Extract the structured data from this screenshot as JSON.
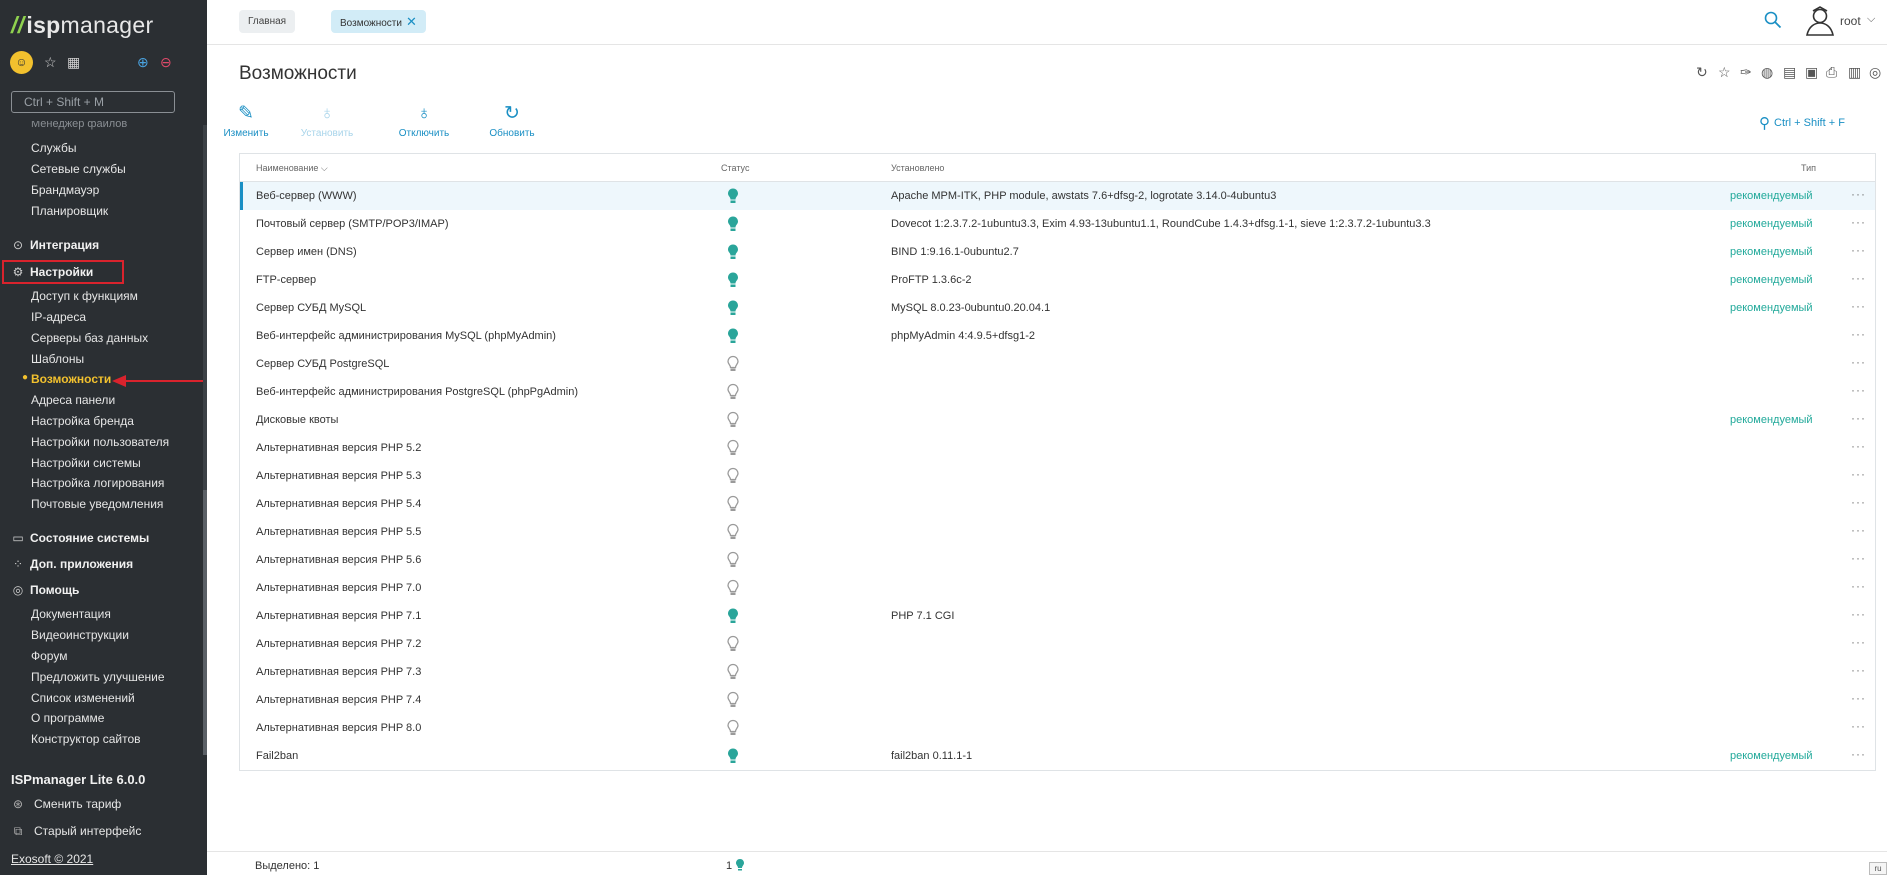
{
  "sidebar": {
    "logo_prefix": "isp",
    "logo_suffix": "manager",
    "search_placeholder": "Ctrl + Shift + M",
    "cut_item": "Менеджер файлов",
    "items_top": [
      "Службы",
      "Сетевые службы",
      "Брандмауэр",
      "Планировщик"
    ],
    "group_integration": "Интеграция",
    "group_settings": "Настройки",
    "settings_items": [
      "Доступ к функциям",
      "IP-адреса",
      "Серверы баз данных",
      "Шаблоны",
      "Возможности",
      "Адреса панели",
      "Настройка бренда",
      "Настройки пользователя",
      "Настройки системы",
      "Настройка логирования",
      "Почтовые уведомления"
    ],
    "group_status": "Состояние системы",
    "group_apps": "Доп. приложения",
    "group_help": "Помощь",
    "help_items": [
      "Документация",
      "Видеоинструкции",
      "Форум",
      "Предложить улучшение",
      "Список изменений",
      "О программе",
      "Конструктор сайтов"
    ],
    "version": "ISPmanager Lite 6.0.0",
    "change_tariff": "Сменить тариф",
    "old_interface": "Старый интерфейс",
    "copyright": "Exosoft © 2021"
  },
  "topbar": {
    "crumb_home": "Главная",
    "crumb_current": "Возможности",
    "user": "root"
  },
  "page": {
    "title": "Возможности",
    "toolbar": {
      "edit": "Изменить",
      "install": "Установить",
      "disable": "Отключить",
      "refresh": "Обновить"
    },
    "filter_hint": "Ctrl + Shift + F",
    "columns": {
      "name": "Наименование",
      "status": "Статус",
      "installed": "Установлено",
      "type": "Тип"
    },
    "rows": [
      {
        "name": "Веб-сервер (WWW)",
        "on": true,
        "installed": "Apache MPM-ITK, PHP module, awstats 7.6+dfsg-2, logrotate 3.14.0-4ubuntu3",
        "type": "рекомендуемый"
      },
      {
        "name": "Почтовый сервер (SMTP/POP3/IMAP)",
        "on": true,
        "installed": "Dovecot 1:2.3.7.2-1ubuntu3.3, Exim 4.93-13ubuntu1.1, RoundCube 1.4.3+dfsg.1-1, sieve 1:2.3.7.2-1ubuntu3.3",
        "type": "рекомендуемый"
      },
      {
        "name": "Сервер имен (DNS)",
        "on": true,
        "installed": "BIND 1:9.16.1-0ubuntu2.7",
        "type": "рекомендуемый"
      },
      {
        "name": "FTP-сервер",
        "on": true,
        "installed": "ProFTP 1.3.6c-2",
        "type": "рекомендуемый"
      },
      {
        "name": "Сервер СУБД MySQL",
        "on": true,
        "installed": "MySQL 8.0.23-0ubuntu0.20.04.1",
        "type": "рекомендуемый"
      },
      {
        "name": "Веб-интерфейс администрирования MySQL (phpMyAdmin)",
        "on": true,
        "installed": "phpMyAdmin 4:4.9.5+dfsg1-2",
        "type": ""
      },
      {
        "name": "Сервер СУБД PostgreSQL",
        "on": false,
        "installed": "",
        "type": ""
      },
      {
        "name": "Веб-интерфейс администрирования PostgreSQL (phpPgAdmin)",
        "on": false,
        "installed": "",
        "type": ""
      },
      {
        "name": "Дисковые квоты",
        "on": false,
        "installed": "",
        "type": "рекомендуемый"
      },
      {
        "name": "Альтернативная версия PHP 5.2",
        "on": false,
        "installed": "",
        "type": ""
      },
      {
        "name": "Альтернативная версия PHP 5.3",
        "on": false,
        "installed": "",
        "type": ""
      },
      {
        "name": "Альтернативная версия PHP 5.4",
        "on": false,
        "installed": "",
        "type": ""
      },
      {
        "name": "Альтернативная версия PHP 5.5",
        "on": false,
        "installed": "",
        "type": ""
      },
      {
        "name": "Альтернативная версия PHP 5.6",
        "on": false,
        "installed": "",
        "type": ""
      },
      {
        "name": "Альтернативная версия PHP 7.0",
        "on": false,
        "installed": "",
        "type": ""
      },
      {
        "name": "Альтернативная версия PHP 7.1",
        "on": true,
        "installed": "PHP 7.1 CGI",
        "type": ""
      },
      {
        "name": "Альтернативная версия PHP 7.2",
        "on": false,
        "installed": "",
        "type": ""
      },
      {
        "name": "Альтернативная версия PHP 7.3",
        "on": false,
        "installed": "",
        "type": ""
      },
      {
        "name": "Альтернативная версия PHP 7.4",
        "on": false,
        "installed": "",
        "type": ""
      },
      {
        "name": "Альтернативная версия PHP 8.0",
        "on": false,
        "installed": "",
        "type": ""
      },
      {
        "name": "Fail2ban",
        "on": true,
        "installed": "fail2ban 0.11.1-1",
        "type": "рекомендуемый"
      }
    ],
    "more_glyph": "···",
    "footer_selected": "Выделено: 1",
    "footer_count": "1",
    "corner_label": "ru"
  },
  "colors": {
    "accent": "#1a8fc4",
    "sidebar_bg": "#2b2f33",
    "active": "#f2c12e",
    "recommended": "#21a99a",
    "bulb_on": "#2aa59a",
    "bulb_off": "#9a9a9a"
  }
}
